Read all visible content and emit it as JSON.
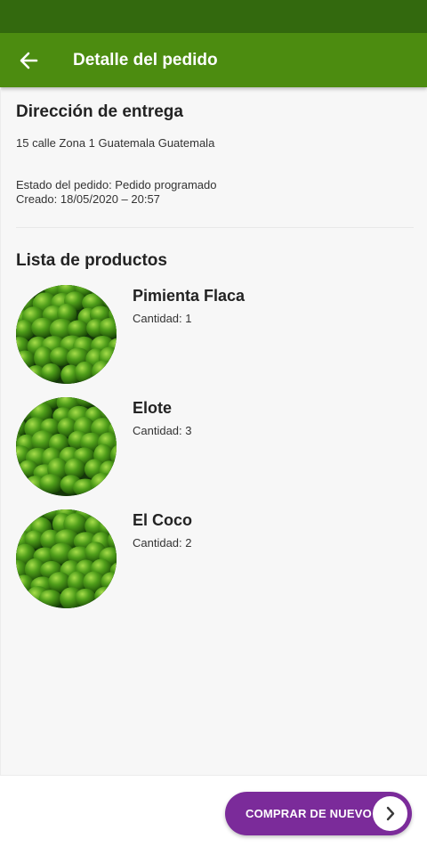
{
  "app_bar": {
    "title": "Detalle del pedido",
    "back_icon": "arrow-left-icon",
    "color": "#4c8c10",
    "status_bar_color": "#33690e"
  },
  "address": {
    "title": "Dirección de entrega",
    "text": "15 calle Zona 1 Guatemala Guatemala"
  },
  "order": {
    "status_line": "Estado del pedido: Pedido programado",
    "created_line": "Creado: 18/05/2020 – 20:57"
  },
  "products": {
    "title": "Lista de productos",
    "items": [
      {
        "name": "Pimienta Flaca",
        "quantity": "Cantidad: 1"
      },
      {
        "name": "Elote",
        "quantity": "Cantidad: 3"
      },
      {
        "name": "El Coco",
        "quantity": "Cantidad: 2"
      }
    ]
  },
  "footer": {
    "buy_again_label": "COMPRAR DE NUEVO",
    "buy_again_icon": "chevron-right-icon",
    "button_color": "#7b2b9a"
  }
}
